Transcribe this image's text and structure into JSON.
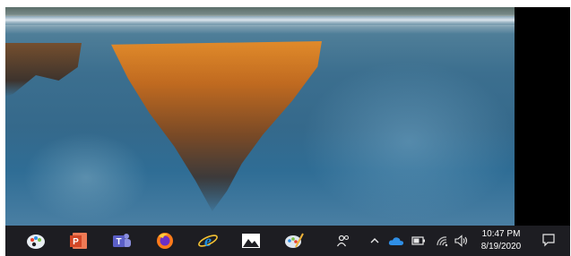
{
  "taskbar": {
    "pinned_apps": [
      {
        "name": "paint-3d",
        "icon": "paint-palette-icon"
      },
      {
        "name": "powerpoint",
        "icon": "powerpoint-icon",
        "label": "P"
      },
      {
        "name": "teams",
        "icon": "teams-icon",
        "label": "T"
      },
      {
        "name": "firefox",
        "icon": "firefox-icon"
      },
      {
        "name": "internet-explorer",
        "icon": "internet-explorer-icon",
        "label": "e"
      },
      {
        "name": "photos",
        "icon": "photos-icon"
      },
      {
        "name": "paint",
        "icon": "paint-icon"
      }
    ],
    "tray": {
      "people_icon": "people-icon",
      "chevron_icon": "chevron-up-icon",
      "onedrive_icon": "onedrive-cloud-icon",
      "battery_icon": "battery-icon",
      "wifi_icon": "wifi-icon",
      "volume_icon": "volume-icon",
      "notification_icon": "action-center-icon"
    },
    "clock": {
      "time": "10:47 PM",
      "date": "8/19/2020"
    }
  },
  "colors": {
    "taskbar_bg": "#1d1d22",
    "onedrive": "#2f8fe6",
    "powerpoint": "#d24726",
    "teams": "#5b5fc7",
    "ie": "#1e8fe0"
  }
}
